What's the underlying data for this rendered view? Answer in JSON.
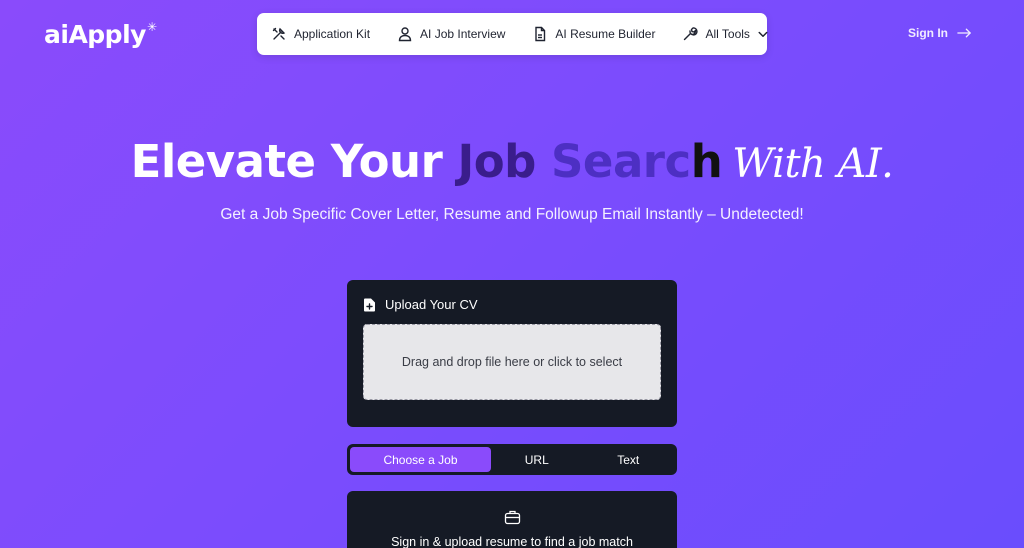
{
  "brand": {
    "logo_text": "aiApply"
  },
  "nav": {
    "items": [
      {
        "label": "Application Kit",
        "icon": "tools-icon"
      },
      {
        "label": "AI Job Interview",
        "icon": "user-icon"
      },
      {
        "label": "AI Resume Builder",
        "icon": "document-icon"
      },
      {
        "label": "All Tools",
        "icon": "wrench-icon"
      }
    ]
  },
  "header": {
    "signin_label": "Sign In"
  },
  "hero": {
    "title_part1": "Elevate Your ",
    "title_part2": "Job ",
    "title_part3": "Searc",
    "title_cursor": "h",
    "title_part4": "With AI.",
    "subtitle": "Get a Job Specific Cover Letter, Resume and Followup Email Instantly – Undetected!"
  },
  "upload": {
    "heading": "Upload Your CV",
    "dropzone_text": "Drag and drop file here or click to select"
  },
  "tabs": [
    {
      "label": "Choose a Job",
      "active": true
    },
    {
      "label": "URL",
      "active": false
    },
    {
      "label": "Text",
      "active": false
    }
  ],
  "job_match": {
    "text": "Sign in & upload resume to find a job match"
  },
  "colors": {
    "accent": "#8a4bfb",
    "card_bg": "#151a25",
    "title_dark": "#3a1d8c"
  }
}
